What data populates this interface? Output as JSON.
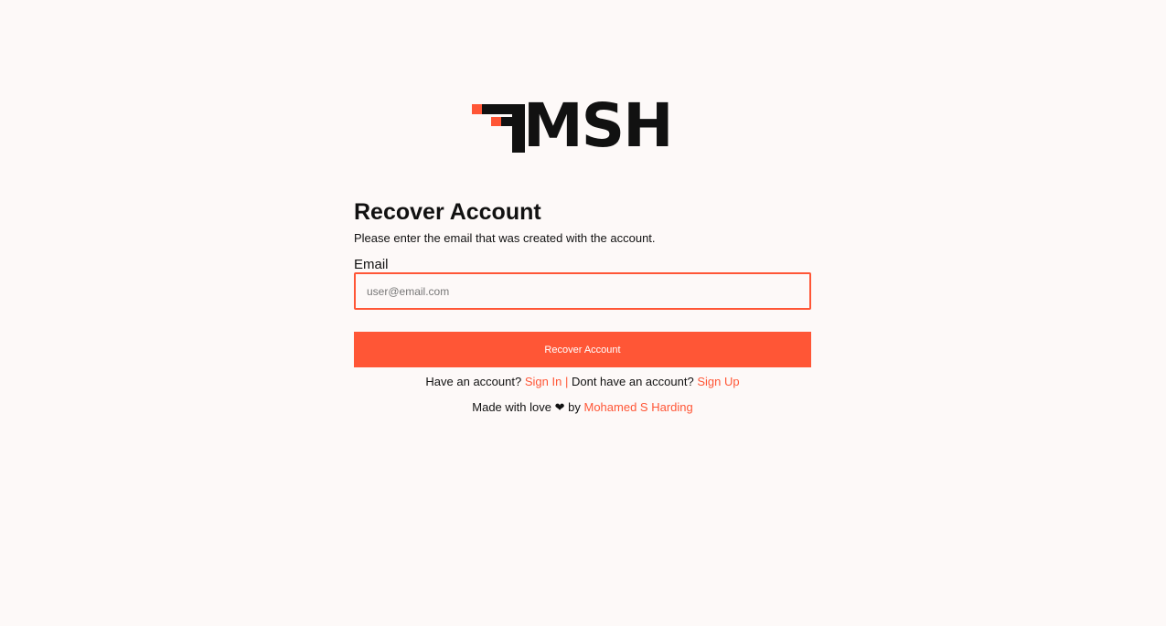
{
  "brand": {
    "logo_text": "MSH",
    "accent_color": "#ff5636"
  },
  "form": {
    "title": "Recover Account",
    "subtitle": "Please enter the email that was created with the account.",
    "email_label": "Email",
    "email_placeholder": "user@email.com",
    "email_value": "",
    "submit_label": "Recover Account"
  },
  "links": {
    "have_account_text": "Have an account?",
    "sign_in_label": "Sign In",
    "separator": "|",
    "no_account_text": "Dont have an account?",
    "sign_up_label": "Sign Up"
  },
  "footer": {
    "made_with_text": "Made with love",
    "heart_icon": "heart-icon",
    "heart_glyph": "❤",
    "by_text": "by",
    "author_name": "Mohamed S Harding"
  }
}
